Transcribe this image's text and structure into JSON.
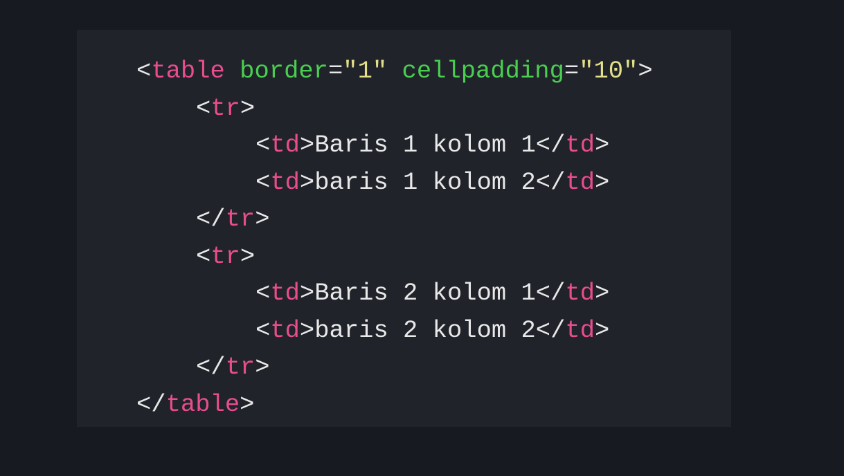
{
  "colors": {
    "page_background": "#181a21",
    "panel_background": "#21232b",
    "punctuation": "#e8e8e8",
    "tag": "#e94d8c",
    "attribute": "#49cf4f",
    "string": "#e4e08a",
    "text": "#e8e8e8"
  },
  "code": {
    "language": "html",
    "lines": [
      {
        "indent": 0,
        "tokens": [
          {
            "t": "punct",
            "v": "<"
          },
          {
            "t": "tag",
            "v": "table"
          },
          {
            "t": "text",
            "v": " "
          },
          {
            "t": "attr",
            "v": "border"
          },
          {
            "t": "punct",
            "v": "="
          },
          {
            "t": "str",
            "v": "\"1\""
          },
          {
            "t": "text",
            "v": " "
          },
          {
            "t": "attr",
            "v": "cellpadding"
          },
          {
            "t": "punct",
            "v": "="
          },
          {
            "t": "str",
            "v": "\"10\""
          },
          {
            "t": "punct",
            "v": ">"
          }
        ]
      },
      {
        "indent": 1,
        "tokens": [
          {
            "t": "punct",
            "v": "<"
          },
          {
            "t": "tag",
            "v": "tr"
          },
          {
            "t": "punct",
            "v": ">"
          }
        ]
      },
      {
        "indent": 2,
        "tokens": [
          {
            "t": "punct",
            "v": "<"
          },
          {
            "t": "tag",
            "v": "td"
          },
          {
            "t": "punct",
            "v": ">"
          },
          {
            "t": "text",
            "v": "Baris 1 kolom 1"
          },
          {
            "t": "punct",
            "v": "</"
          },
          {
            "t": "tag",
            "v": "td"
          },
          {
            "t": "punct",
            "v": ">"
          }
        ]
      },
      {
        "indent": 2,
        "tokens": [
          {
            "t": "punct",
            "v": "<"
          },
          {
            "t": "tag",
            "v": "td"
          },
          {
            "t": "punct",
            "v": ">"
          },
          {
            "t": "text",
            "v": "baris 1 kolom 2"
          },
          {
            "t": "punct",
            "v": "</"
          },
          {
            "t": "tag",
            "v": "td"
          },
          {
            "t": "punct",
            "v": ">"
          }
        ]
      },
      {
        "indent": 1,
        "tokens": [
          {
            "t": "punct",
            "v": "</"
          },
          {
            "t": "tag",
            "v": "tr"
          },
          {
            "t": "punct",
            "v": ">"
          }
        ]
      },
      {
        "indent": 1,
        "tokens": [
          {
            "t": "punct",
            "v": "<"
          },
          {
            "t": "tag",
            "v": "tr"
          },
          {
            "t": "punct",
            "v": ">"
          }
        ]
      },
      {
        "indent": 2,
        "tokens": [
          {
            "t": "punct",
            "v": "<"
          },
          {
            "t": "tag",
            "v": "td"
          },
          {
            "t": "punct",
            "v": ">"
          },
          {
            "t": "text",
            "v": "Baris 2 kolom 1"
          },
          {
            "t": "punct",
            "v": "</"
          },
          {
            "t": "tag",
            "v": "td"
          },
          {
            "t": "punct",
            "v": ">"
          }
        ]
      },
      {
        "indent": 2,
        "tokens": [
          {
            "t": "punct",
            "v": "<"
          },
          {
            "t": "tag",
            "v": "td"
          },
          {
            "t": "punct",
            "v": ">"
          },
          {
            "t": "text",
            "v": "baris 2 kolom 2"
          },
          {
            "t": "punct",
            "v": "</"
          },
          {
            "t": "tag",
            "v": "td"
          },
          {
            "t": "punct",
            "v": ">"
          }
        ]
      },
      {
        "indent": 1,
        "tokens": [
          {
            "t": "punct",
            "v": "</"
          },
          {
            "t": "tag",
            "v": "tr"
          },
          {
            "t": "punct",
            "v": ">"
          }
        ]
      },
      {
        "indent": 0,
        "tokens": [
          {
            "t": "punct",
            "v": "</"
          },
          {
            "t": "tag",
            "v": "table"
          },
          {
            "t": "punct",
            "v": ">"
          }
        ]
      }
    ]
  }
}
